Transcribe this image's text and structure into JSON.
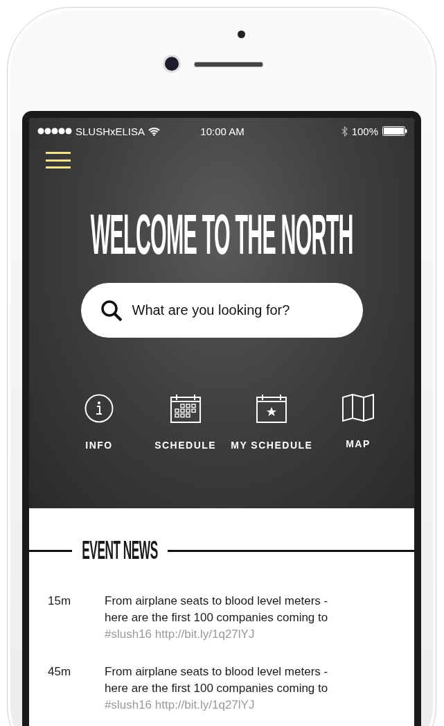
{
  "status_bar": {
    "carrier": "SLUSHxELISA",
    "time": "10:00 AM",
    "battery": "100%"
  },
  "title": "WELCOME TO THE NORTH",
  "search": {
    "placeholder": "What are you looking for?"
  },
  "nav": [
    {
      "label": "INFO",
      "kind": "info"
    },
    {
      "label": "SCHEDULE",
      "kind": "schedule"
    },
    {
      "label": "MY SCHEDULE",
      "kind": "my-schedule"
    },
    {
      "label": "MAP",
      "kind": "map"
    }
  ],
  "news": {
    "heading": "EVENT NEWS",
    "items": [
      {
        "time": "15m",
        "text": "From airplane seats to blood level meters - here are the first 100 companies coming to",
        "tags": "#slush16 http://bit.ly/1q27lYJ"
      },
      {
        "time": "45m",
        "text": "From airplane seats to blood level meters - here are the first 100 companies coming to",
        "tags": "#slush16 http://bit.ly/1q27lYJ"
      }
    ]
  }
}
